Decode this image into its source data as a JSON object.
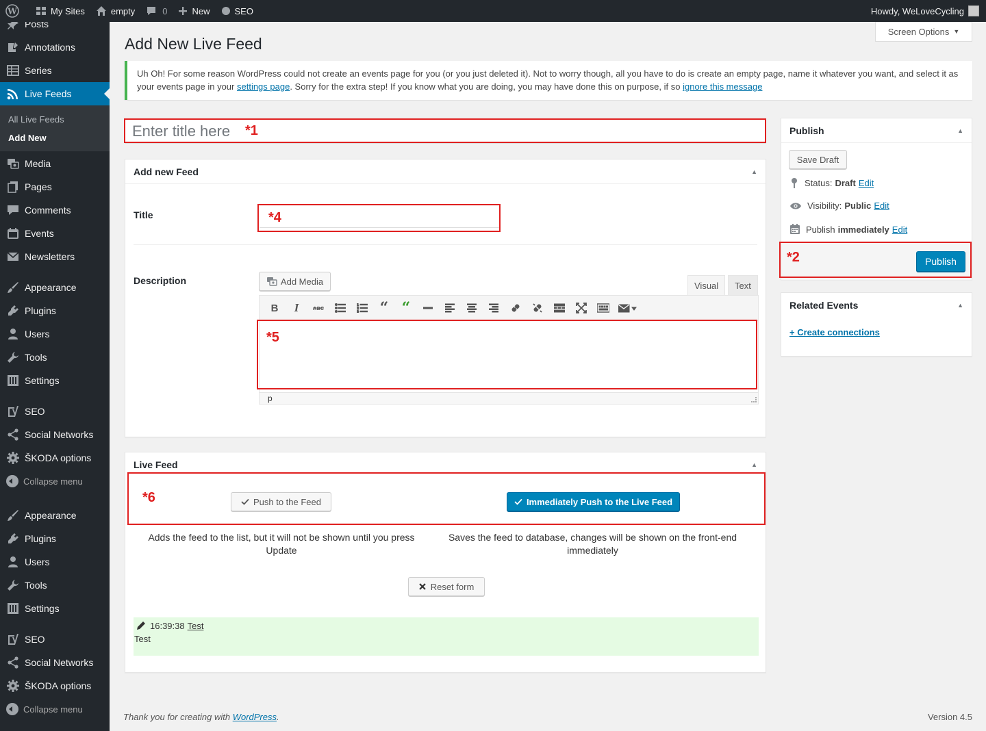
{
  "adminbar": {
    "my_sites": "My Sites",
    "site_name": "empty",
    "comments_count": "0",
    "new_label": "New",
    "seo_label": "SEO",
    "howdy": "Howdy, WeLoveCycling"
  },
  "sidebar": {
    "posts": "Posts",
    "annotations": "Annotations",
    "series": "Series",
    "live_feeds": "Live Feeds",
    "sub_all": "All Live Feeds",
    "sub_add": "Add New",
    "media": "Media",
    "pages": "Pages",
    "comments": "Comments",
    "events": "Events",
    "newsletters": "Newsletters",
    "appearance": "Appearance",
    "plugins": "Plugins",
    "users": "Users",
    "tools": "Tools",
    "settings": "Settings",
    "seo": "SEO",
    "social_networks": "Social Networks",
    "skoda_options": "ŠKODA options",
    "collapse": "Collapse menu"
  },
  "screen_options": "Screen Options",
  "page_title": "Add New Live Feed",
  "notice": {
    "text1": "Uh Oh! For some reason WordPress could not create an events page for you (or you just deleted it). Not to worry though, all you have to do is create an empty page, name it whatever you want, and select it as your events page in your ",
    "link1": "settings page",
    "text2": ". Sorry for the extra step! If you know what you are doing, you may have done this on purpose, if so ",
    "link2": "ignore this message"
  },
  "title_placeholder": "Enter title here",
  "feedbox": {
    "heading": "Add new Feed",
    "title_label": "Title",
    "description_label": "Description",
    "add_media": "Add Media",
    "tab_visual": "Visual",
    "tab_text": "Text",
    "status_path": "p"
  },
  "livebox": {
    "heading": "Live Feed",
    "push_label": "Push to the Feed",
    "push_live_label": "Immediately Push to the Live Feed",
    "help_push": "Adds the feed to the list, but it will not be shown until you press Update",
    "help_push_live": "Saves the feed to database, changes will be shown on the front-end immediately",
    "reset_label": "Reset form",
    "entry_time": "16:39:38",
    "entry_title": "Test",
    "entry_body": "Test"
  },
  "publish": {
    "heading": "Publish",
    "save_draft": "Save Draft",
    "status_label": "Status:",
    "status_value": "Draft",
    "visibility_label": "Visibility:",
    "visibility_value": "Public",
    "publish_label": "Publish",
    "publish_value": "immediately",
    "edit": "Edit",
    "publish_button": "Publish"
  },
  "related": {
    "heading": "Related Events",
    "create_link": "+ Create connections"
  },
  "annotations": {
    "a1": "*1",
    "a2": "*2",
    "a4": "*4",
    "a5": "*5",
    "a6": "*6"
  },
  "footer": {
    "thanks_prefix": "Thank you for creating with ",
    "wordpress": "WordPress",
    "thanks_suffix": ".",
    "version": "Version 4.5"
  },
  "colors": {
    "accent": "#0073aa",
    "annotation": "#e02020",
    "notice_border": "#46b450"
  }
}
